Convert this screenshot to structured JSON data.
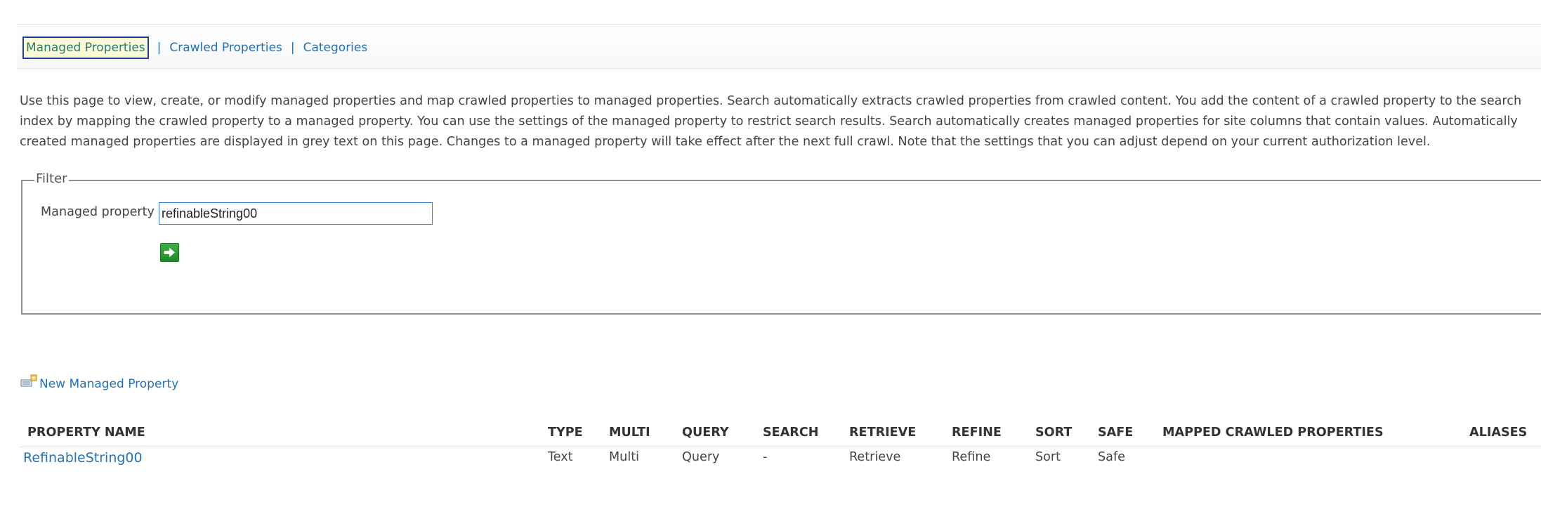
{
  "tabs": {
    "managed": "Managed Properties",
    "crawled": "Crawled Properties",
    "categories": "Categories",
    "separator": "|"
  },
  "description": "Use this page to view, create, or modify managed properties and map crawled properties to managed properties. Search automatically extracts crawled properties from crawled content. You add the content of a crawled property to the search index by mapping the crawled property to a managed property. You can use the settings of the managed property to restrict search results. Search automatically creates managed properties for site columns that contain values. Automatically created managed properties are displayed in grey text on this page. Changes to a managed property will take effect after the next full crawl. Note that the settings that you can adjust depend on your current authorization level.",
  "filter": {
    "legend": "Filter",
    "label": "Managed property",
    "value": "refinableString00",
    "go_icon": "arrow-right-icon"
  },
  "new_property": {
    "label": "New Managed Property",
    "icon": "new-item-icon"
  },
  "table": {
    "headers": {
      "name": "PROPERTY NAME",
      "type": "TYPE",
      "multi": "MULTI",
      "query": "QUERY",
      "search": "SEARCH",
      "retrieve": "RETRIEVE",
      "refine": "REFINE",
      "sort": "SORT",
      "safe": "SAFE",
      "mapped": "MAPPED CRAWLED PROPERTIES",
      "aliases": "ALIASES"
    },
    "rows": [
      {
        "name": "RefinableString00",
        "type": "Text",
        "multi": "Multi",
        "query": "Query",
        "search": "-",
        "retrieve": "Retrieve",
        "refine": "Refine",
        "sort": "Sort",
        "safe": "Safe",
        "mapped": "",
        "aliases": ""
      }
    ]
  },
  "colors": {
    "link": "#2672b8",
    "active_tab_bg": "#fbfbd6",
    "active_tab_border": "#1e3f8f",
    "go_button": "#2e9e38"
  }
}
